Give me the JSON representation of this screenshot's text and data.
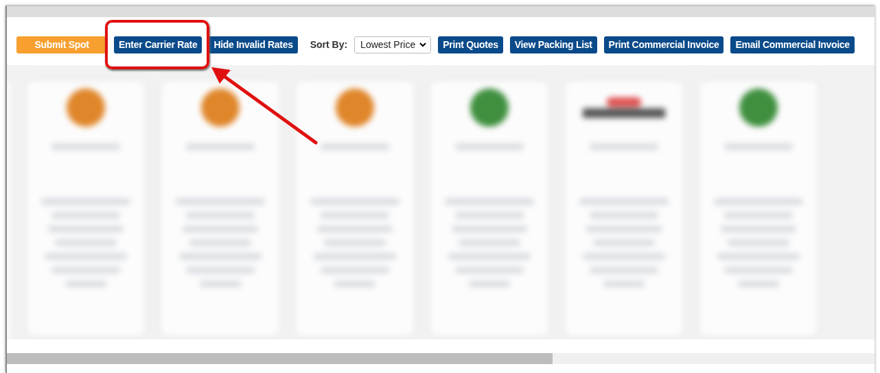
{
  "toolbar": {
    "buttons": [
      {
        "label": "Submit Spot",
        "kind": "accent"
      },
      {
        "label": "Enter Carrier Rate",
        "kind": "primary"
      },
      {
        "label": "Hide Invalid Rates",
        "kind": "primary"
      }
    ],
    "sort": {
      "label": "Sort By:",
      "value": "Lowest Price"
    },
    "actions": [
      {
        "label": "Print Quotes",
        "kind": "primary"
      },
      {
        "label": "View Packing List",
        "kind": "primary"
      },
      {
        "label": "Print Commercial Invoice",
        "kind": "primary"
      },
      {
        "label": "Email Commercial Invoice",
        "kind": "primary"
      }
    ]
  },
  "quotes": [
    {
      "kind": "round",
      "color": "#e0862a"
    },
    {
      "kind": "round",
      "color": "#e0862a"
    },
    {
      "kind": "round",
      "color": "#e0862a"
    },
    {
      "kind": "round",
      "color": "#3f8f3f"
    },
    {
      "kind": "wide",
      "color": "#e05050"
    },
    {
      "kind": "round",
      "color": "#3f8f3f"
    }
  ]
}
